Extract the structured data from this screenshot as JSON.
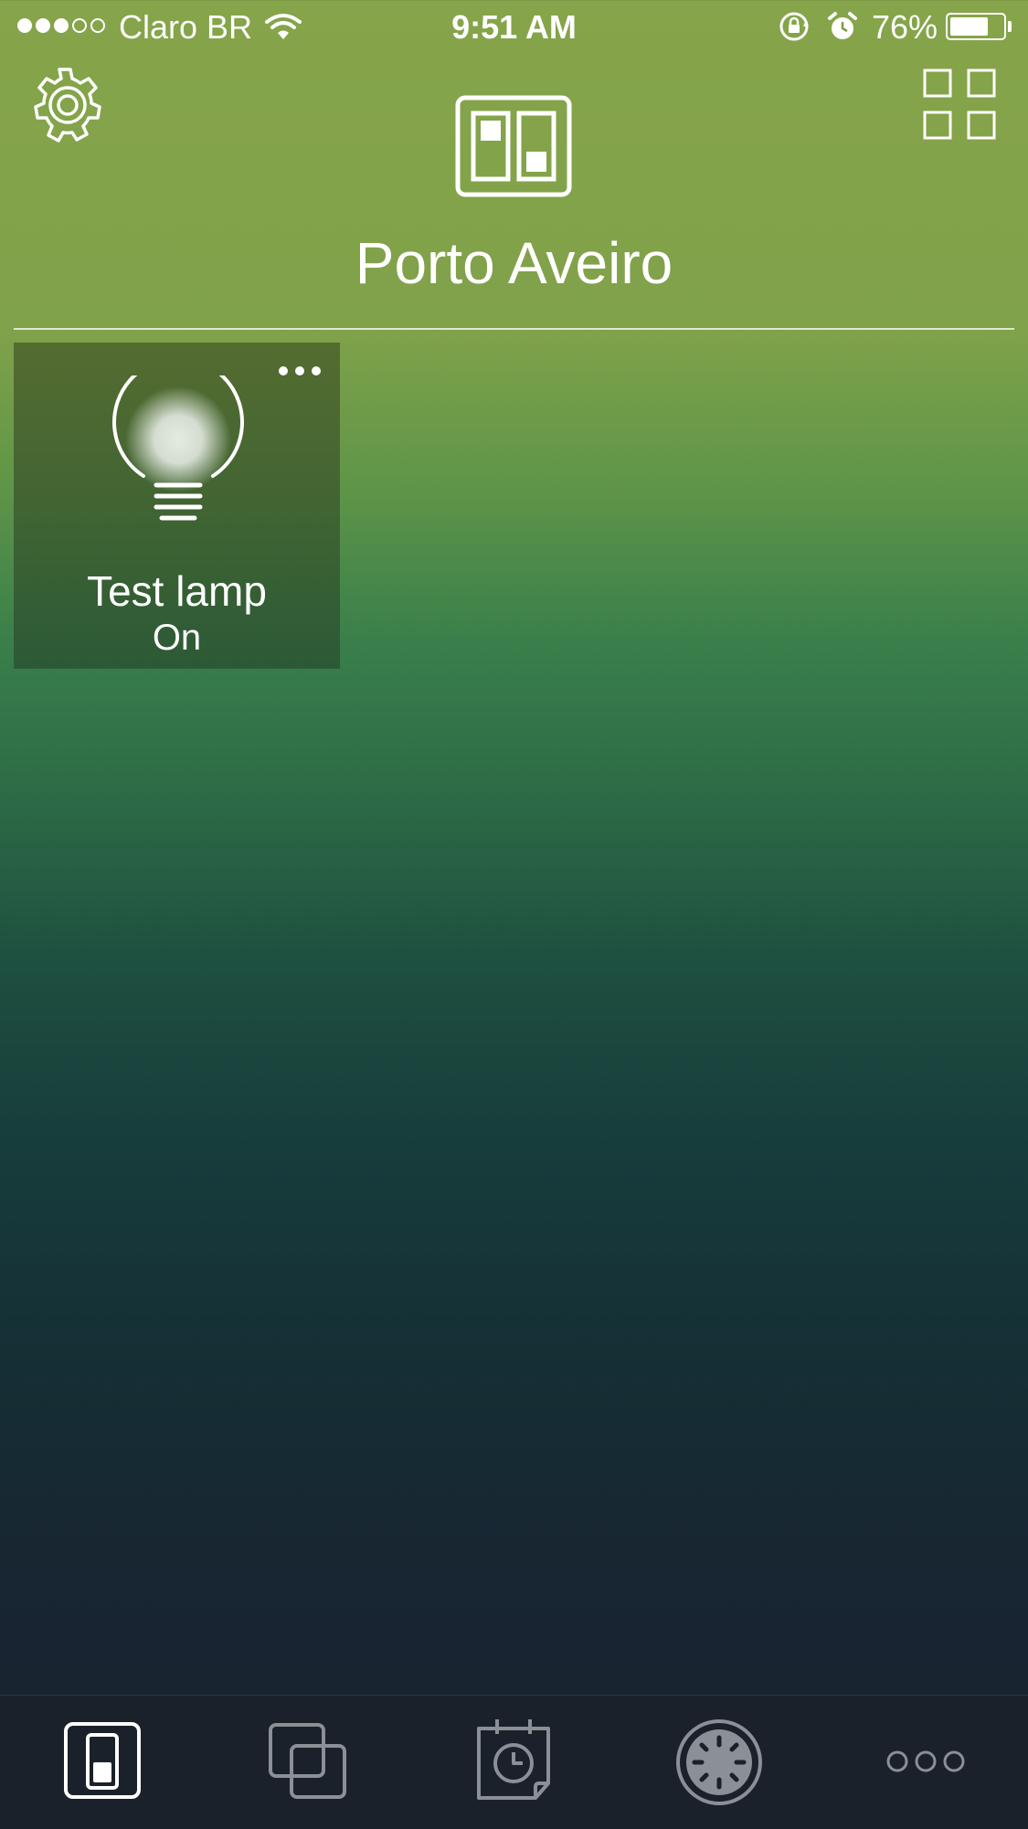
{
  "status_bar": {
    "carrier": "Claro BR",
    "time": "9:51 AM",
    "battery_percent": "76%",
    "battery_level": 0.76,
    "signal_bars": 3,
    "signal_total": 5
  },
  "header": {
    "title": "Porto Aveiro",
    "icons": [
      "gear-icon",
      "switch-panel-icon",
      "grid-view-icon"
    ]
  },
  "devices": [
    {
      "name": "Test lamp",
      "state": "On",
      "icon": "lightbulb-icon"
    }
  ],
  "tab_bar": {
    "tabs": [
      {
        "icon": "device-switch-icon",
        "active": true
      },
      {
        "icon": "scenes-icon",
        "active": false
      },
      {
        "icon": "schedule-icon",
        "active": false
      },
      {
        "icon": "dial-icon",
        "active": false
      },
      {
        "icon": "more-icon",
        "active": false
      }
    ]
  },
  "colors": {
    "gradient_top": "#86a44a",
    "gradient_mid": "#3a7f4b",
    "gradient_bottom": "#1a2230",
    "tab_bar_bg": "#1a212a",
    "tab_icon_inactive": "#8a9096"
  }
}
